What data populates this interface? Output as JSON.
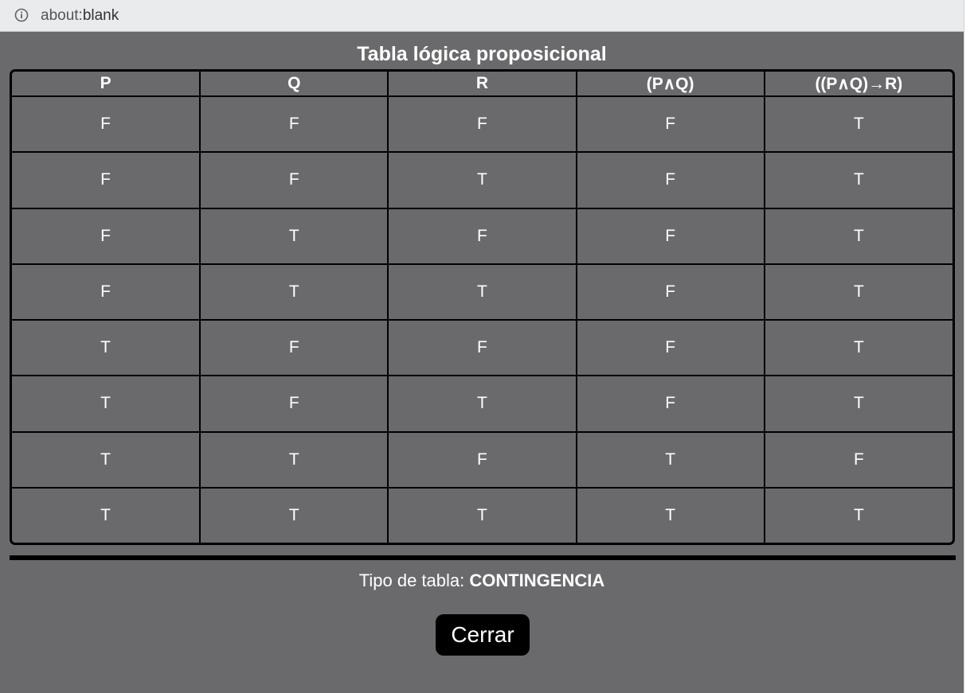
{
  "browser": {
    "url_prefix": "about:",
    "url_rest": "blank"
  },
  "page": {
    "title": "Tabla lógica proposicional",
    "table": {
      "headers": [
        "P",
        "Q",
        "R",
        "(P∧Q)",
        "((P∧Q)→R)"
      ],
      "rows": [
        [
          "F",
          "F",
          "F",
          "F",
          "T"
        ],
        [
          "F",
          "F",
          "T",
          "F",
          "T"
        ],
        [
          "F",
          "T",
          "F",
          "F",
          "T"
        ],
        [
          "F",
          "T",
          "T",
          "F",
          "T"
        ],
        [
          "T",
          "F",
          "F",
          "F",
          "T"
        ],
        [
          "T",
          "F",
          "T",
          "F",
          "T"
        ],
        [
          "T",
          "T",
          "F",
          "T",
          "F"
        ],
        [
          "T",
          "T",
          "T",
          "T",
          "T"
        ]
      ]
    },
    "tipo_label": "Tipo de tabla: ",
    "tipo_value": "CONTINGENCIA",
    "close_label": "Cerrar"
  },
  "colors": {
    "background": "#6a6a6c",
    "text": "#ffffff",
    "borders": "#000000"
  }
}
